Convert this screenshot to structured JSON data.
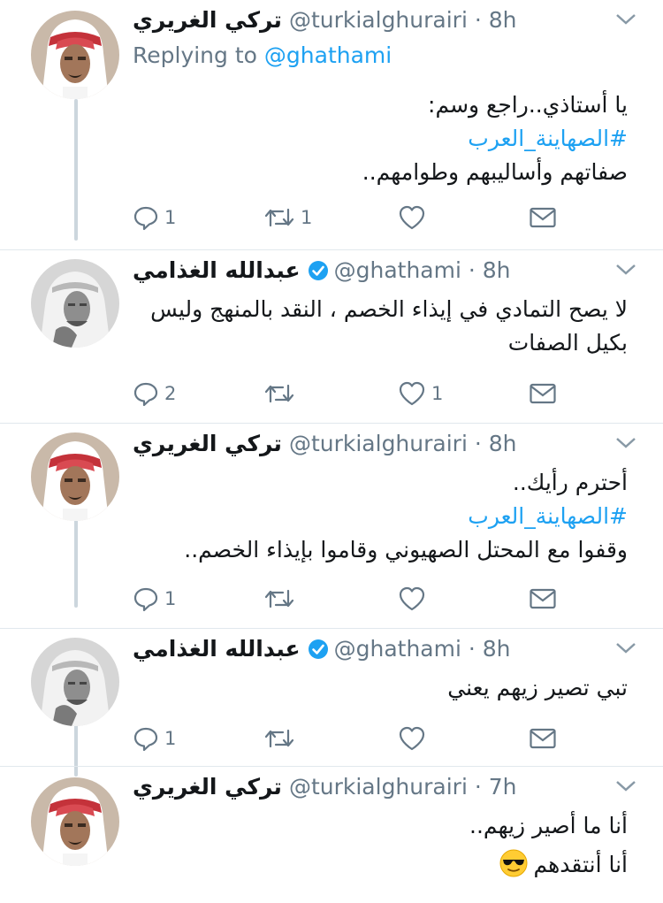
{
  "tweets": [
    {
      "name": "تركي الغريري",
      "handle": "@turkialghurairi",
      "dot": "·",
      "time": "8h",
      "verified": false,
      "replying_label": "Replying to",
      "replying_handle": "@ghathami",
      "lines": [
        "يا أستاذي..راجع وسم:",
        "#الصهاينة_العرب",
        "صفاتهم وأساليبهم وطوامهم.."
      ],
      "actions": {
        "reply": "1",
        "retweet": "1",
        "like": "",
        "dm": ""
      }
    },
    {
      "name": "عبدالله الغذامي",
      "handle": "@ghathami",
      "dot": "·",
      "time": "8h",
      "verified": true,
      "lines": [
        "لا يصح التمادي في إيذاء الخصم ، النقد بالمنهج وليس",
        "بكيل الصفات"
      ],
      "actions": {
        "reply": "2",
        "retweet": "",
        "like": "1",
        "dm": ""
      }
    },
    {
      "name": "تركي الغريري",
      "handle": "@turkialghurairi",
      "dot": "·",
      "time": "8h",
      "verified": false,
      "lines": [
        "أحترم رأيك..",
        "#الصهاينة_العرب",
        "وقفوا مع المحتل الصهيوني وقاموا بإيذاء الخصم.."
      ],
      "actions": {
        "reply": "1",
        "retweet": "",
        "like": "",
        "dm": ""
      }
    },
    {
      "name": "عبدالله الغذامي",
      "handle": "@ghathami",
      "dot": "·",
      "time": "8h",
      "verified": true,
      "lines": [
        "تبي تصير زيهم يعني"
      ],
      "actions": {
        "reply": "1",
        "retweet": "",
        "like": "",
        "dm": ""
      }
    },
    {
      "name": "تركي الغريري",
      "handle": "@turkialghurairi",
      "dot": "·",
      "time": "7h",
      "verified": false,
      "lines": [
        "أنا ما أصير زيهم..",
        "أنا أنتقدهم"
      ],
      "emoji": "😎",
      "actions": {}
    }
  ],
  "colors": {
    "link": "#1da1f2",
    "secondary": "#657786",
    "thread": "#ccd6dd",
    "divider": "#e1e8ed"
  }
}
